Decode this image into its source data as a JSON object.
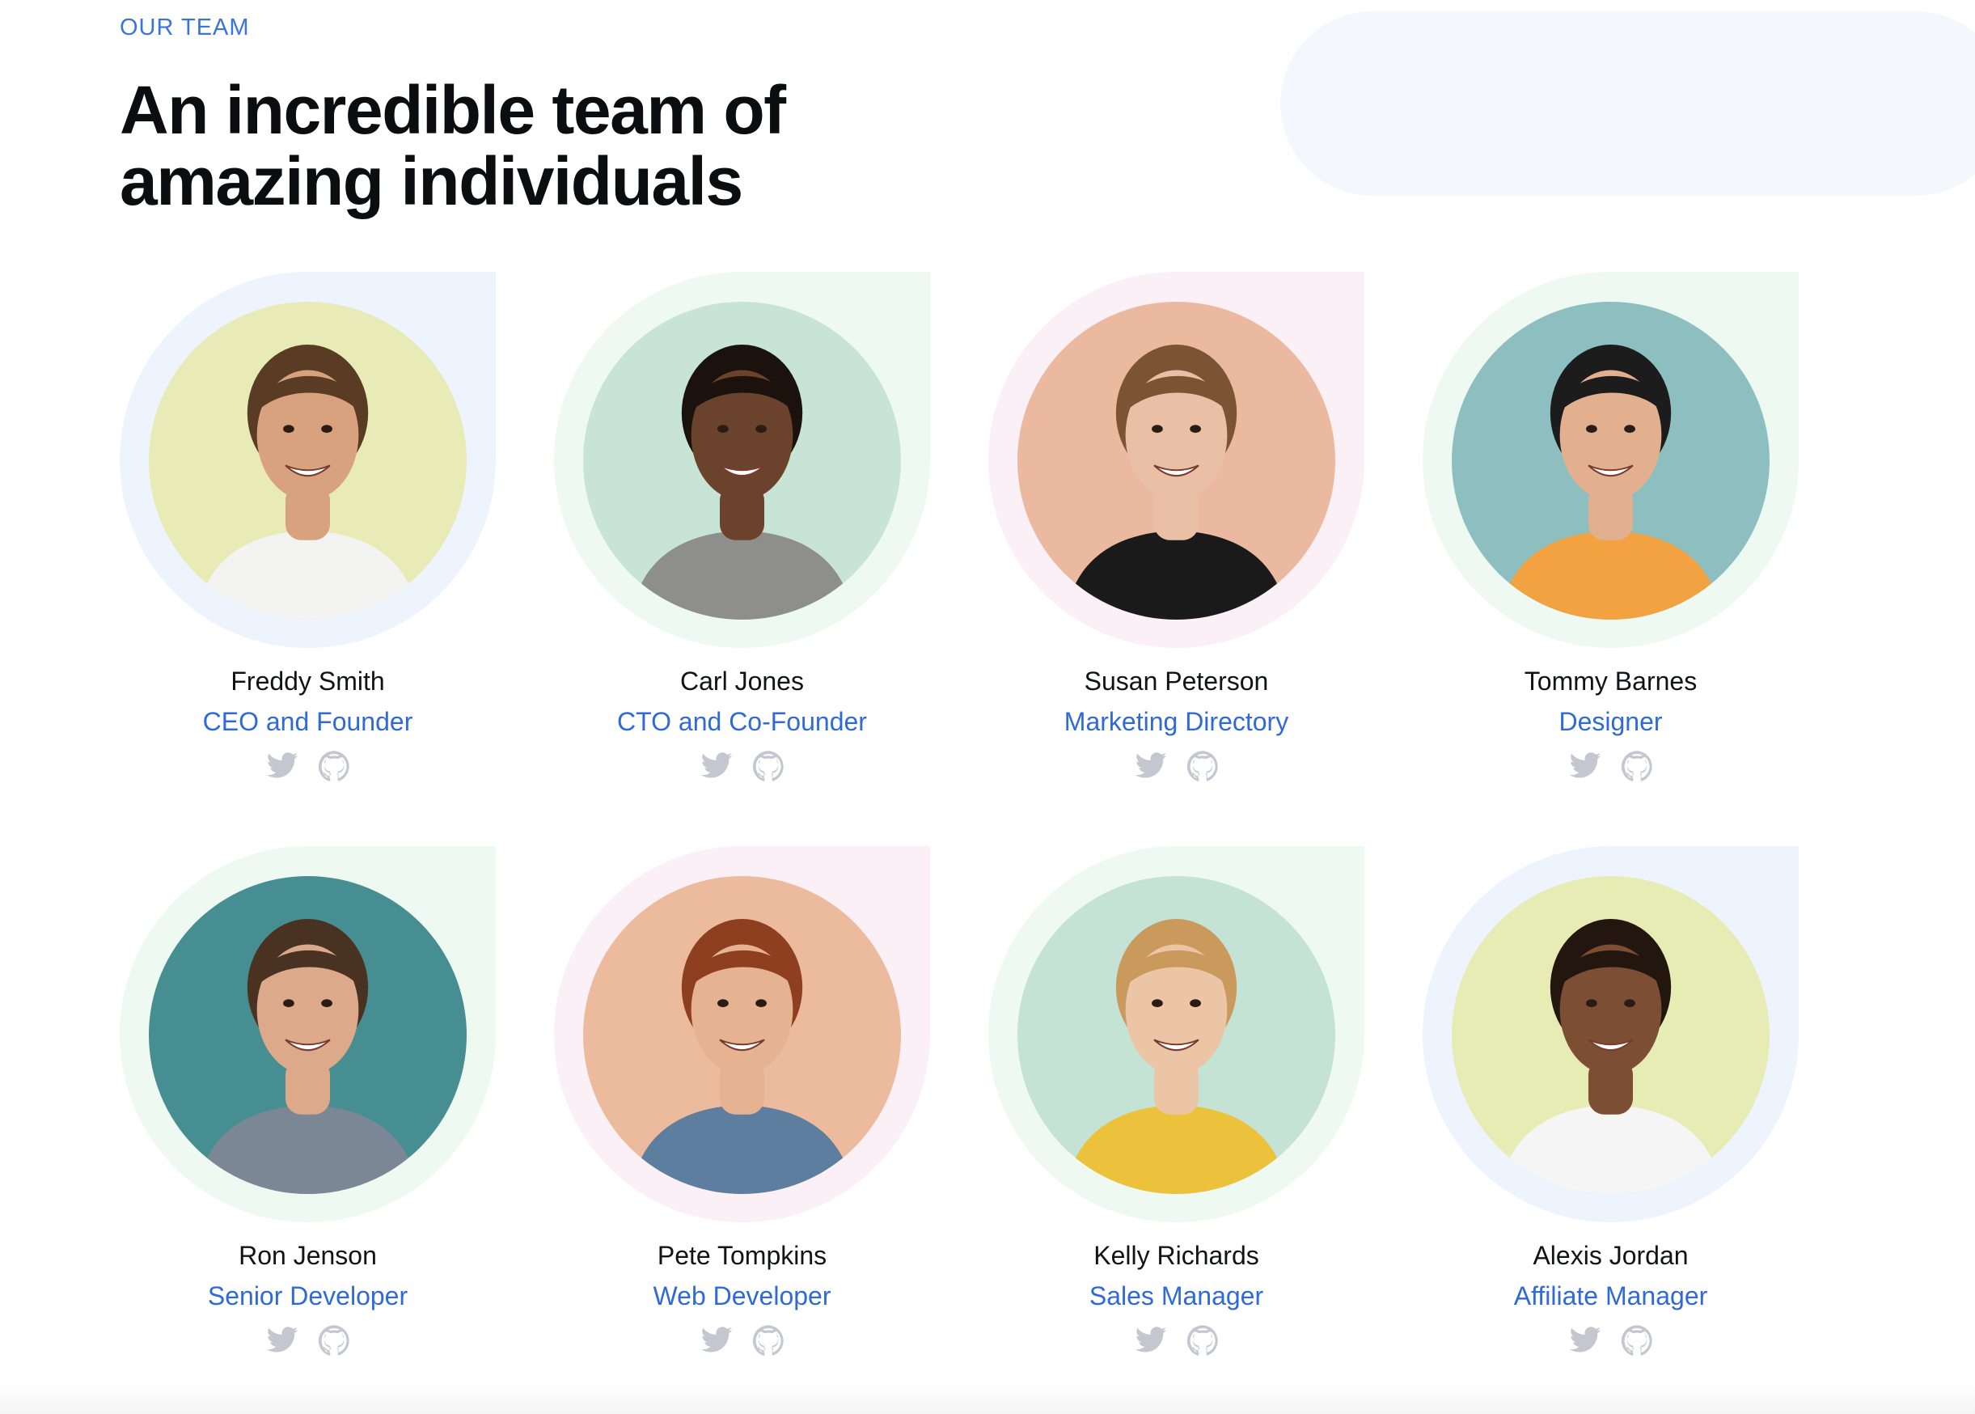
{
  "section": {
    "eyebrow": "OUR TEAM",
    "headline_line1": "An incredible team of",
    "headline_line2": "amazing individuals"
  },
  "colors": {
    "accent": "#2f6ad6",
    "icon_gray": "#c4c7cf"
  },
  "team": [
    {
      "name": "Freddy Smith",
      "role": "CEO and Founder",
      "backdrop": "blue",
      "photo_bg": "#e8ebb5",
      "skin": "#d9a27e",
      "hair": "#5a3b24",
      "shirt": "#f3f3f1",
      "socials": [
        "twitter-icon",
        "github-icon"
      ]
    },
    {
      "name": "Carl Jones",
      "role": "CTO and Co-Founder",
      "backdrop": "green",
      "photo_bg": "#c7e4d6",
      "skin": "#6b432c",
      "hair": "#1b120d",
      "shirt": "#8e8e8c",
      "socials": [
        "twitter-icon",
        "github-icon"
      ]
    },
    {
      "name": "Susan Peterson",
      "role": "Marketing Directory",
      "backdrop": "pink",
      "photo_bg": "#ebb9a0",
      "skin": "#e9c0a6",
      "hair": "#7b5533",
      "shirt": "#1a1a1a",
      "socials": [
        "twitter-icon",
        "github-icon"
      ]
    },
    {
      "name": "Tommy Barnes",
      "role": "Designer",
      "backdrop": "green",
      "photo_bg": "#8dbfc0",
      "skin": "#e3b08f",
      "hair": "#1c1c1c",
      "shirt": "#f2a241",
      "socials": [
        "twitter-icon",
        "github-icon"
      ]
    },
    {
      "name": "Ron Jenson",
      "role": "Senior Developer",
      "backdrop": "green",
      "photo_bg": "#468e92",
      "skin": "#dca98a",
      "hair": "#4a3222",
      "shirt": "#7c8796",
      "socials": [
        "twitter-icon",
        "github-icon"
      ]
    },
    {
      "name": "Pete Tompkins",
      "role": "Web Developer",
      "backdrop": "pink",
      "photo_bg": "#ecbb9d",
      "skin": "#e6b392",
      "hair": "#8d3f20",
      "shirt": "#5e7ea0",
      "socials": [
        "twitter-icon",
        "github-icon"
      ]
    },
    {
      "name": "Kelly Richards",
      "role": "Sales Manager",
      "backdrop": "green",
      "photo_bg": "#c4e3d4",
      "skin": "#ecc4a6",
      "hair": "#c99a5c",
      "shirt": "#ecc13c",
      "socials": [
        "twitter-icon",
        "github-icon"
      ]
    },
    {
      "name": "Alexis Jordan",
      "role": "Affiliate Manager",
      "backdrop": "blue",
      "photo_bg": "#e7ecb4",
      "skin": "#7c4e34",
      "hair": "#22160f",
      "shirt": "#f5f5f5",
      "socials": [
        "twitter-icon",
        "github-icon"
      ]
    }
  ]
}
